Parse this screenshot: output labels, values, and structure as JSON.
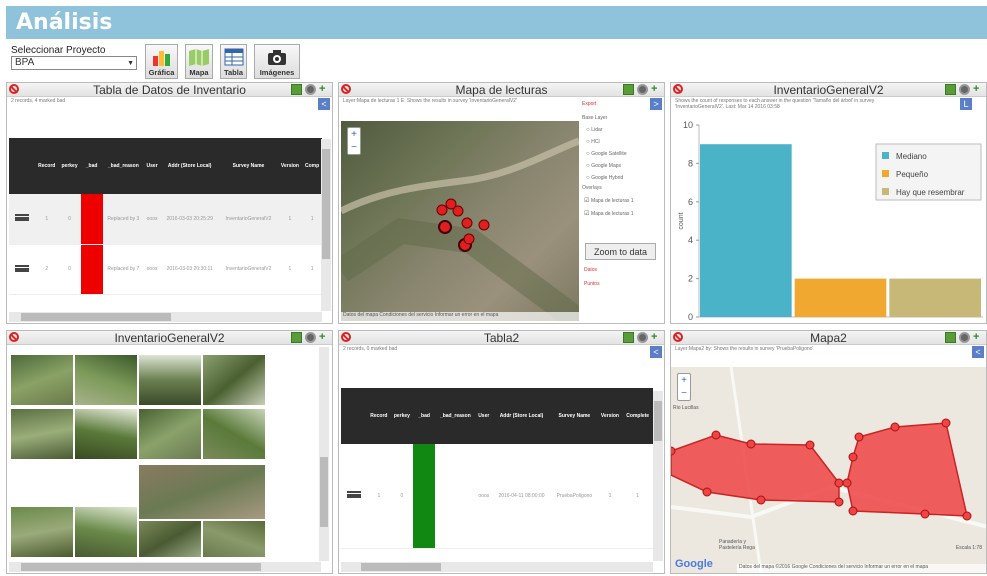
{
  "header": {
    "title": "Análisis"
  },
  "project": {
    "label": "Seleccionar Proyecto",
    "selected": "BPA"
  },
  "toolbar": [
    {
      "label": "Gráfica",
      "icon": "bar-chart-icon"
    },
    {
      "label": "Mapa",
      "icon": "map-icon"
    },
    {
      "label": "Tabla",
      "icon": "table-icon"
    },
    {
      "label": "Imágenes",
      "icon": "camera-icon"
    }
  ],
  "panels": {
    "table1": {
      "title": "Tabla de Datos de Inventario",
      "note": "2 records, 4 marked bad",
      "columns": [
        "Record",
        "perkey",
        "_bad",
        "_bad_reason",
        "User",
        "Addr (Store Local)",
        "Survey Name",
        "Version",
        "Comp"
      ],
      "rows": [
        {
          "record": "1",
          "perkey": "0",
          "bad": "",
          "reason": "Replaced by 3",
          "user": "ooos",
          "date": "2016-03-03 20:25:29",
          "survey": "InventarioGeneralV2",
          "version": "1",
          "comp": "1"
        },
        {
          "record": "2",
          "perkey": "0",
          "bad": "",
          "reason": "Replaced by 7",
          "user": "ooos",
          "date": "2016-03-03 20:30:11",
          "survey": "InventarioGeneralV2",
          "version": "1",
          "comp": "1"
        }
      ],
      "bad_color": "#ee0000"
    },
    "map1": {
      "title": "Mapa de lecturas",
      "note": "Layer:Mapa de lecturas 1 E: Shows the results in survey 'InventarioGeneralV2'",
      "side_title": "Export",
      "base_label": "Base Layer",
      "base_layers": [
        "Lidar",
        "HCl",
        "Google Satellite",
        "Google Maps",
        "Google Hybrid"
      ],
      "overlay_label": "Overlays",
      "overlays": [
        "Mapa de lecturas 1",
        "Mapa de lecturas 1"
      ],
      "zoom_button": "Zoom to data",
      "links": [
        "Datos",
        "Puntos"
      ],
      "footer": "Datos del mapa    Condiciones del servicio    Informar un error en el mapa",
      "point_color": "#e02020"
    },
    "chart1": {
      "title": "InventarioGeneralV2",
      "note": "Shows the count of responses to each answer in the question 'Tamaño del árbol' in survey 'InventarioGeneralV2'. Last: Mar 14 2016 03:58",
      "nav_label": "L"
    },
    "photos": {
      "title": "InventarioGeneralV2"
    },
    "table2": {
      "title": "Tabla2",
      "note": "2 records, 0 marked bad",
      "columns": [
        "Record",
        "perkey",
        "_bad",
        "_bad_reason",
        "User",
        "Addr (Store Local)",
        "Survey Name",
        "Version",
        "Complete"
      ],
      "row": {
        "record": "1",
        "perkey": "0",
        "bad": "",
        "reason": "",
        "user": "ooos",
        "date": "2016-04-11 08:00:00",
        "survey": "PruebaPoligono",
        "version": "1",
        "comp": "1"
      },
      "good_color": "#118811"
    },
    "map2": {
      "title": "Mapa2",
      "note": "Layer:Mapa2 by: Shows the results in survey 'PruebaPoligono'",
      "place1": "Rio Lucillas",
      "place2": "Panadería y Pastelería Rega",
      "scale": "Escala 1:78",
      "footer": "Datos del mapa ©2016 Google   Condiciones del servicio   Informar un error en el mapa",
      "brand": "Google",
      "polygon_color": "#ee4444"
    }
  },
  "chart_data": {
    "type": "bar",
    "title": "",
    "xlabel": "",
    "ylabel": "count",
    "ylim": [
      0,
      10
    ],
    "yticks": [
      0,
      2,
      4,
      6,
      8,
      10
    ],
    "categories": [
      "Mediano",
      "Pequeño",
      "Hay que resembrar"
    ],
    "values": [
      9,
      2,
      2
    ],
    "colors": [
      "#4bb3c8",
      "#f0a830",
      "#c8b878"
    ],
    "legend_position": "top-right"
  }
}
